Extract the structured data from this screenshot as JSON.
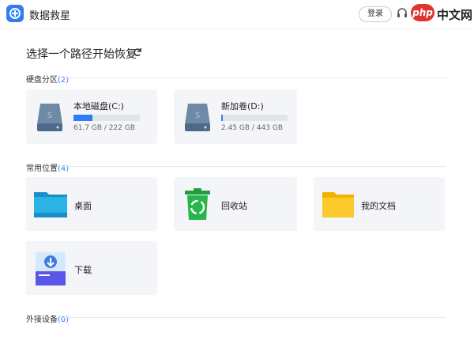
{
  "app": {
    "title": "数据救星"
  },
  "header": {
    "login_label": "登录"
  },
  "brand": {
    "p": "php",
    "text": "中文网"
  },
  "main": {
    "heading": "选择一个路径开始恢复",
    "sections": {
      "disks": {
        "label": "硬盘分区",
        "count": "(2)"
      },
      "common": {
        "label": "常用位置",
        "count": "(4)"
      },
      "external": {
        "label": "外接设备",
        "count": "(0)"
      }
    },
    "drives": [
      {
        "label": "本地磁盘(C:)",
        "size": "61.7 GB / 222 GB",
        "used_fraction": 0.28
      },
      {
        "label": "新加卷(D:)",
        "size": "2.45 GB / 443 GB",
        "used_fraction": 0.01
      }
    ],
    "locations": [
      {
        "label": "桌面",
        "icon": "desktop-folder-icon"
      },
      {
        "label": "回收站",
        "icon": "recycle-bin-icon"
      },
      {
        "label": "我的文档",
        "icon": "documents-folder-icon"
      },
      {
        "label": "下载",
        "icon": "download-icon"
      }
    ]
  },
  "colors": {
    "accent": "#2f7cf6",
    "card_bg": "#f4f5f8"
  }
}
